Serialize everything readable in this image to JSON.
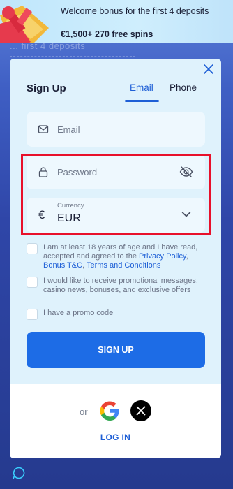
{
  "banner": {
    "title": "Welcome bonus for the first 4 deposits",
    "subtitle": "€1,500+ 270 free spins",
    "background_ghost": "... first 4 deposits"
  },
  "signup": {
    "title": "Sign Up",
    "tabs": [
      {
        "label": "Email",
        "active": true
      },
      {
        "label": "Phone",
        "active": false
      }
    ],
    "email_placeholder": "Email",
    "password_placeholder": "Password",
    "currency": {
      "label": "Currency",
      "symbol": "€",
      "value": "EUR"
    },
    "checks": {
      "age": {
        "prefix": "I am at least 18 years of age and I have read, accepted and agreed to the ",
        "privacy": "Privacy Policy",
        "sep1": ", ",
        "bonus": "Bonus T&C",
        "sep2": ", ",
        "terms": "Terms and Conditions",
        "checked": false
      },
      "promo_messages": {
        "label": "I would like to receive promotional messages, casino news, bonuses, and exclusive offers",
        "checked": false
      },
      "promo_code": {
        "label": "I have a promo code",
        "checked": false
      }
    },
    "submit_label": "SIGN UP",
    "or_label": "or",
    "login_label": "LOG IN"
  },
  "colors": {
    "accent": "#1d6ce6",
    "highlight": "#e8102a",
    "modal_bg": "#dff2fc"
  },
  "icons": [
    "close-icon",
    "mail-icon",
    "lock-icon",
    "eye-off-icon",
    "chevron-down-icon",
    "google-icon",
    "x-logo-icon",
    "chat-icon"
  ]
}
